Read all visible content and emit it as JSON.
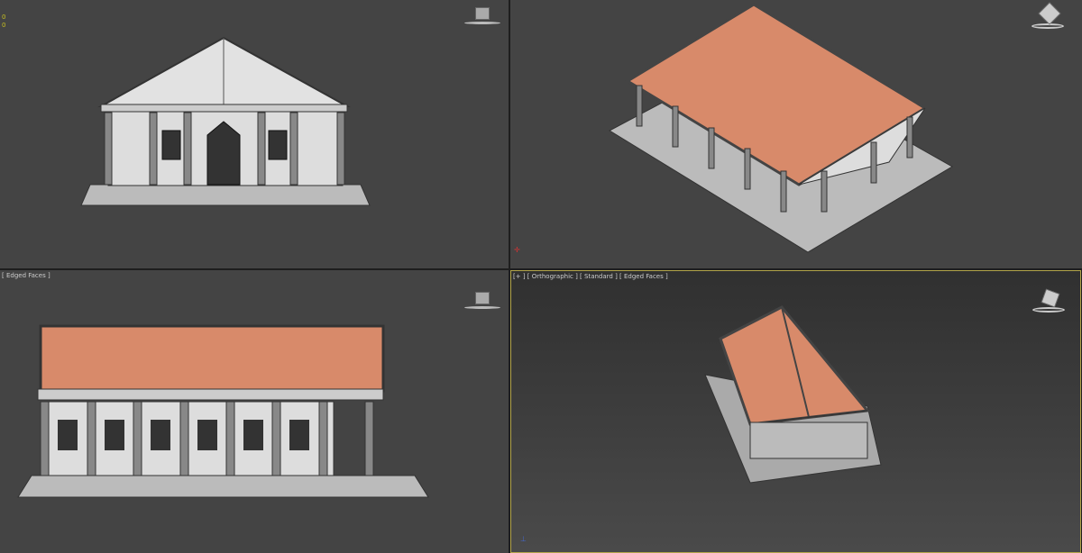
{
  "viewports": {
    "top_left": {
      "stats": [
        "0",
        "0"
      ]
    },
    "top_right": {},
    "bottom_left": {
      "label": "[ Edged Faces ]"
    },
    "bottom_right": {
      "label": "[+ ] [ Orthographic ] [ Standard ] [ Edged Faces ]",
      "active": true
    }
  },
  "colors": {
    "roof": "#d88a6a",
    "wall": "#dcdcdc",
    "bg": "#444444",
    "active_border": "#b3a54a"
  }
}
